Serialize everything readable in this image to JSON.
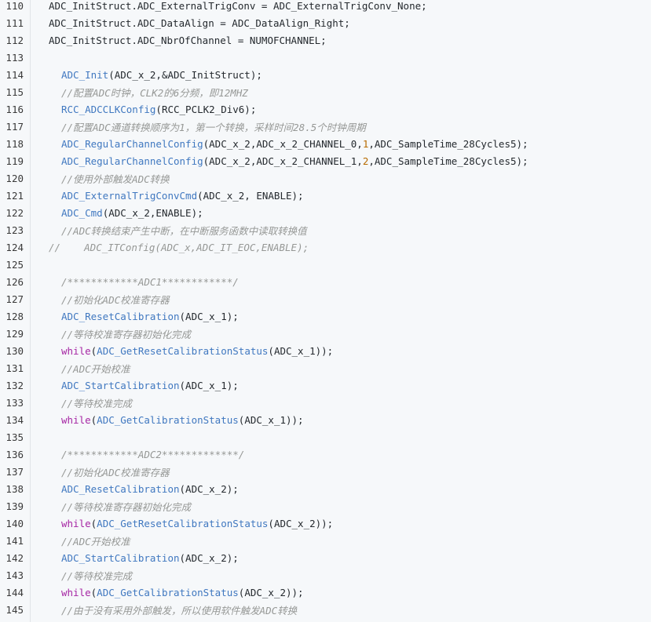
{
  "code_view": {
    "lines": [
      {
        "number": "110",
        "indent": 0,
        "tokens": [
          {
            "t": "ADC_InitStruct.ADC_ExternalTrigConv = ADC_ExternalTrigConv_None;",
            "c": "pl"
          }
        ]
      },
      {
        "number": "111",
        "indent": 0,
        "tokens": [
          {
            "t": "ADC_InitStruct.ADC_DataAlign = ADC_DataAlign_Right;",
            "c": "pl"
          }
        ]
      },
      {
        "number": "112",
        "indent": 0,
        "tokens": [
          {
            "t": "ADC_InitStruct.ADC_NbrOfChannel = NUMOFCHANNEL;",
            "c": "pl"
          }
        ]
      },
      {
        "number": "113",
        "indent": 0,
        "tokens": []
      },
      {
        "number": "114",
        "indent": 1,
        "tokens": [
          {
            "t": "ADC_Init",
            "c": "fn"
          },
          {
            "t": "(ADC_x_2,&ADC_InitStruct);",
            "c": "pl"
          }
        ]
      },
      {
        "number": "115",
        "indent": 1,
        "tokens": [
          {
            "t": "//配置ADC时钟，CLK2的6分频，即12MHZ",
            "c": "cm"
          }
        ]
      },
      {
        "number": "116",
        "indent": 1,
        "tokens": [
          {
            "t": "RCC_ADCCLKConfig",
            "c": "fn"
          },
          {
            "t": "(RCC_PCLK2_Div6);",
            "c": "pl"
          }
        ]
      },
      {
        "number": "117",
        "indent": 1,
        "tokens": [
          {
            "t": "//配置ADC通道转换顺序为1，第一个转换，采样时间28.5个时钟周期",
            "c": "cm"
          }
        ]
      },
      {
        "number": "118",
        "indent": 1,
        "tokens": [
          {
            "t": "ADC_RegularChannelConfig",
            "c": "fn"
          },
          {
            "t": "(ADC_x_2,ADC_x_2_CHANNEL_0,",
            "c": "pl"
          },
          {
            "t": "1",
            "c": "num"
          },
          {
            "t": ",ADC_SampleTime_28Cycles5);",
            "c": "pl"
          }
        ]
      },
      {
        "number": "119",
        "indent": 1,
        "tokens": [
          {
            "t": "ADC_RegularChannelConfig",
            "c": "fn"
          },
          {
            "t": "(ADC_x_2,ADC_x_2_CHANNEL_1,",
            "c": "pl"
          },
          {
            "t": "2",
            "c": "num"
          },
          {
            "t": ",ADC_SampleTime_28Cycles5);",
            "c": "pl"
          }
        ]
      },
      {
        "number": "120",
        "indent": 1,
        "tokens": [
          {
            "t": "//使用外部触发ADC转换",
            "c": "cm"
          }
        ]
      },
      {
        "number": "121",
        "indent": 1,
        "tokens": [
          {
            "t": "ADC_ExternalTrigConvCmd",
            "c": "fn"
          },
          {
            "t": "(ADC_x_2, ENABLE);",
            "c": "pl"
          }
        ]
      },
      {
        "number": "122",
        "indent": 1,
        "tokens": [
          {
            "t": "ADC_Cmd",
            "c": "fn"
          },
          {
            "t": "(ADC_x_2,ENABLE);",
            "c": "pl"
          }
        ]
      },
      {
        "number": "123",
        "indent": 1,
        "tokens": [
          {
            "t": "//ADC转换结束产生中断，在中断服务函数中读取转换值",
            "c": "cm"
          }
        ]
      },
      {
        "number": "124",
        "indent": 0,
        "tokens": [
          {
            "t": "//    ADC_ITConfig(ADC_x,ADC_IT_EOC,ENABLE);",
            "c": "cm"
          }
        ]
      },
      {
        "number": "125",
        "indent": 0,
        "tokens": []
      },
      {
        "number": "126",
        "indent": 1,
        "tokens": [
          {
            "t": "/************ADC1************/",
            "c": "cm"
          }
        ]
      },
      {
        "number": "127",
        "indent": 1,
        "tokens": [
          {
            "t": "//初始化ADC校准寄存器",
            "c": "cm"
          }
        ]
      },
      {
        "number": "128",
        "indent": 1,
        "tokens": [
          {
            "t": "ADC_ResetCalibration",
            "c": "fn"
          },
          {
            "t": "(ADC_x_1);",
            "c": "pl"
          }
        ]
      },
      {
        "number": "129",
        "indent": 1,
        "tokens": [
          {
            "t": "//等待校准寄存器初始化完成",
            "c": "cm"
          }
        ]
      },
      {
        "number": "130",
        "indent": 1,
        "tokens": [
          {
            "t": "while",
            "c": "kw"
          },
          {
            "t": "(",
            "c": "pl"
          },
          {
            "t": "ADC_GetResetCalibrationStatus",
            "c": "fn"
          },
          {
            "t": "(ADC_x_1));",
            "c": "pl"
          }
        ]
      },
      {
        "number": "131",
        "indent": 1,
        "tokens": [
          {
            "t": "//ADC开始校准",
            "c": "cm"
          }
        ]
      },
      {
        "number": "132",
        "indent": 1,
        "tokens": [
          {
            "t": "ADC_StartCalibration",
            "c": "fn"
          },
          {
            "t": "(ADC_x_1);",
            "c": "pl"
          }
        ]
      },
      {
        "number": "133",
        "indent": 1,
        "tokens": [
          {
            "t": "//等待校准完成",
            "c": "cm"
          }
        ]
      },
      {
        "number": "134",
        "indent": 1,
        "tokens": [
          {
            "t": "while",
            "c": "kw"
          },
          {
            "t": "(",
            "c": "pl"
          },
          {
            "t": "ADC_GetCalibrationStatus",
            "c": "fn"
          },
          {
            "t": "(ADC_x_1));",
            "c": "pl"
          }
        ]
      },
      {
        "number": "135",
        "indent": 0,
        "tokens": []
      },
      {
        "number": "136",
        "indent": 1,
        "tokens": [
          {
            "t": "/************ADC2*************/",
            "c": "cm"
          }
        ]
      },
      {
        "number": "137",
        "indent": 1,
        "tokens": [
          {
            "t": "//初始化ADC校准寄存器",
            "c": "cm"
          }
        ]
      },
      {
        "number": "138",
        "indent": 1,
        "tokens": [
          {
            "t": "ADC_ResetCalibration",
            "c": "fn"
          },
          {
            "t": "(ADC_x_2);",
            "c": "pl"
          }
        ]
      },
      {
        "number": "139",
        "indent": 1,
        "tokens": [
          {
            "t": "//等待校准寄存器初始化完成",
            "c": "cm"
          }
        ]
      },
      {
        "number": "140",
        "indent": 1,
        "tokens": [
          {
            "t": "while",
            "c": "kw"
          },
          {
            "t": "(",
            "c": "pl"
          },
          {
            "t": "ADC_GetResetCalibrationStatus",
            "c": "fn"
          },
          {
            "t": "(ADC_x_2));",
            "c": "pl"
          }
        ]
      },
      {
        "number": "141",
        "indent": 1,
        "tokens": [
          {
            "t": "//ADC开始校准",
            "c": "cm"
          }
        ]
      },
      {
        "number": "142",
        "indent": 1,
        "tokens": [
          {
            "t": "ADC_StartCalibration",
            "c": "fn"
          },
          {
            "t": "(ADC_x_2);",
            "c": "pl"
          }
        ]
      },
      {
        "number": "143",
        "indent": 1,
        "tokens": [
          {
            "t": "//等待校准完成",
            "c": "cm"
          }
        ]
      },
      {
        "number": "144",
        "indent": 1,
        "tokens": [
          {
            "t": "while",
            "c": "kw"
          },
          {
            "t": "(",
            "c": "pl"
          },
          {
            "t": "ADC_GetCalibrationStatus",
            "c": "fn"
          },
          {
            "t": "(ADC_x_2));",
            "c": "pl"
          }
        ]
      },
      {
        "number": "145",
        "indent": 1,
        "tokens": [
          {
            "t": "//由于没有采用外部触发，所以使用软件触发ADC转换",
            "c": "cm"
          }
        ]
      }
    ]
  }
}
